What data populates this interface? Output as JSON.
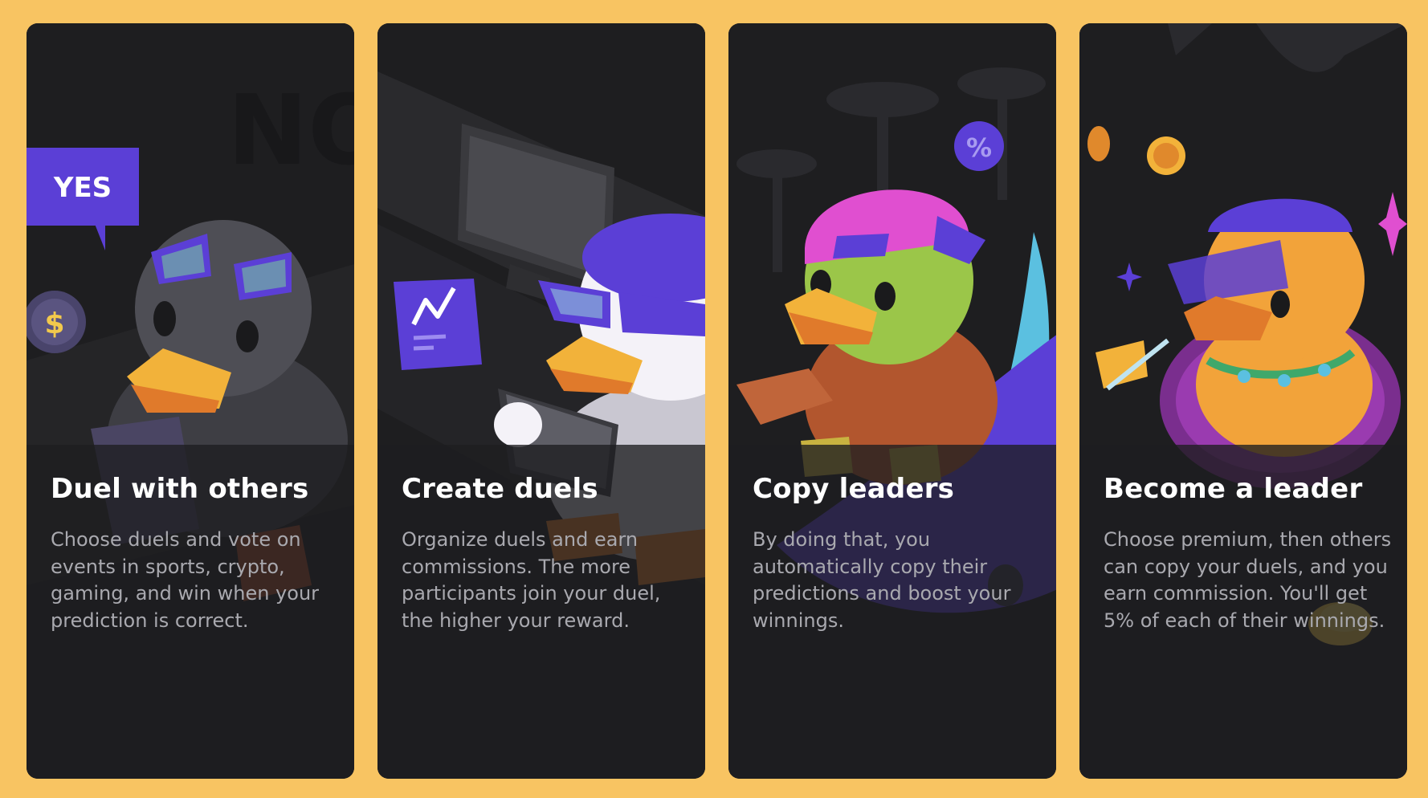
{
  "colors": {
    "background": "#F8C462",
    "card": "#1E1E20",
    "title": "#FFFFFF",
    "description": "#A9A9AF",
    "accent_purple": "#5B3FD6",
    "accent_pink": "#E04FD0",
    "coin_gold": "#F2B23A"
  },
  "cards": [
    {
      "title": "Duel with others",
      "description": "Choose duels and vote on events in sports, crypto, gaming, and win when your prediction is correct.",
      "badge": "YES",
      "background_text": "NO",
      "illustration": "grey-duck-with-sunglasses-and-phone"
    },
    {
      "title": "Create duels",
      "description": "Organize duels and earn commissions. The more participants join your duel, the higher your reward.",
      "illustration": "white-duck-with-tablet"
    },
    {
      "title": "Copy leaders",
      "description": "By doing that, you automatically copy their predictions and boost your winnings.",
      "bubble_symbol": "%",
      "illustration": "green-duck-on-surfboard"
    },
    {
      "title": "Become a leader",
      "description": "Choose premium, then others can copy your duels, and you earn commission. You'll get 5% of each of their winnings.",
      "illustration": "orange-duck-with-drink"
    }
  ]
}
